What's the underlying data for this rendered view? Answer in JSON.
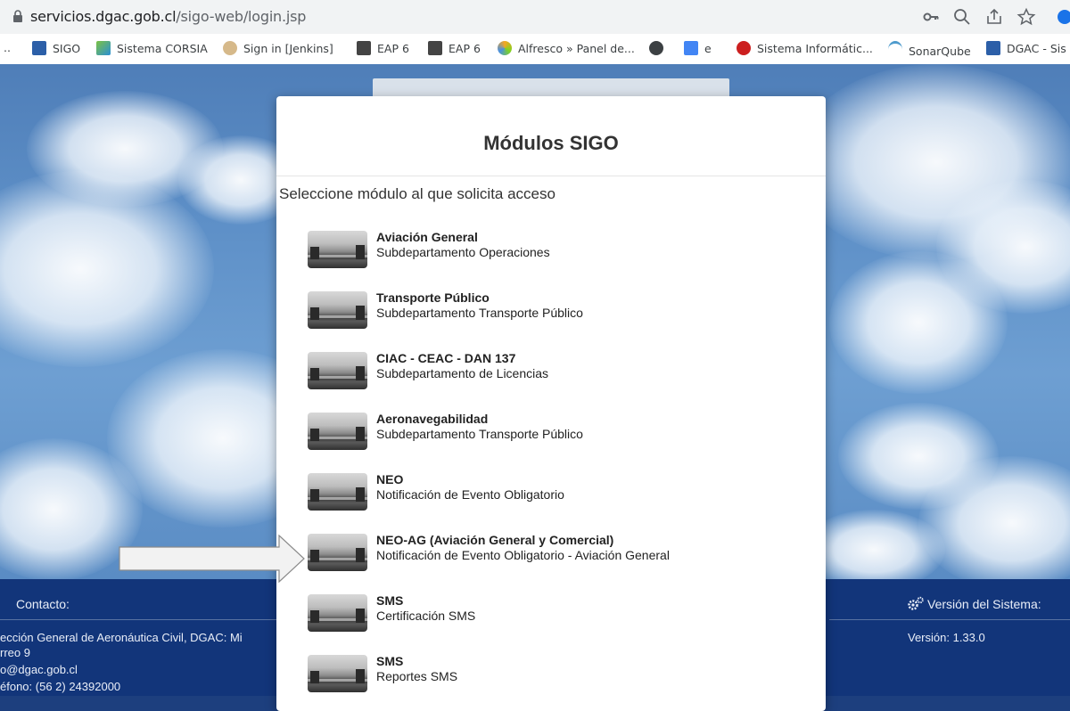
{
  "browser": {
    "url_host": "servicios.dgac.gob.cl",
    "url_path": "/sigo-web/login.jsp",
    "bookmarks": [
      {
        "label": "..",
        "icon": "ellipsis"
      },
      {
        "label": "SIGO",
        "icon": "sigo-favicon"
      },
      {
        "label": "Sistema CORSIA",
        "icon": "corsia-favicon"
      },
      {
        "label": "Sign in [Jenkins]",
        "icon": "jenkins-favicon"
      },
      {
        "label": "EAP 6",
        "icon": "eap-favicon"
      },
      {
        "label": "EAP 6",
        "icon": "eap-favicon"
      },
      {
        "label": "Alfresco » Panel de...",
        "icon": "alfresco-favicon"
      },
      {
        "label": "",
        "icon": "globe-favicon"
      },
      {
        "label": "e",
        "icon": "docs-favicon"
      },
      {
        "label": "Sistema Informátic...",
        "icon": "redhat-favicon"
      },
      {
        "label": "SonarQube",
        "icon": "sonarqube-favicon"
      },
      {
        "label": "DGAC - Sis",
        "icon": "dgac-favicon"
      }
    ]
  },
  "modal": {
    "title": "Módulos SIGO",
    "subtitle": "Seleccione módulo al que solicita acceso",
    "modules": [
      {
        "title": "Aviación General",
        "subtitle": "Subdepartamento Operaciones"
      },
      {
        "title": "Transporte Público",
        "subtitle": "Subdepartamento Transporte Público"
      },
      {
        "title": "CIAC - CEAC - DAN 137",
        "subtitle": "Subdepartamento de Licencias"
      },
      {
        "title": "Aeronavegabilidad",
        "subtitle": "Subdepartamento Transporte Público"
      },
      {
        "title": "NEO",
        "subtitle": "Notificación de Evento Obligatorio"
      },
      {
        "title": "NEO-AG (Aviación General y Comercial)",
        "subtitle": "Notificación de Evento Obligatorio - Aviación General"
      },
      {
        "title": "SMS",
        "subtitle": "Certificación SMS"
      },
      {
        "title": "SMS",
        "subtitle": "Reportes SMS"
      }
    ]
  },
  "footer": {
    "contact_title": "Contacto:",
    "lines": [
      "ección General de Aeronáutica Civil, DGAC: Mi",
      "rreo 9",
      "o@dgac.gob.cl",
      "éfono: (56 2) 24392000"
    ],
    "version_title": "Versión del Sistema:",
    "version": "Versión: 1.33.0"
  },
  "colors": {
    "footer_bg": "#12357a",
    "modal_bg": "#ffffff",
    "chrome_bg": "#f1f3f4"
  }
}
